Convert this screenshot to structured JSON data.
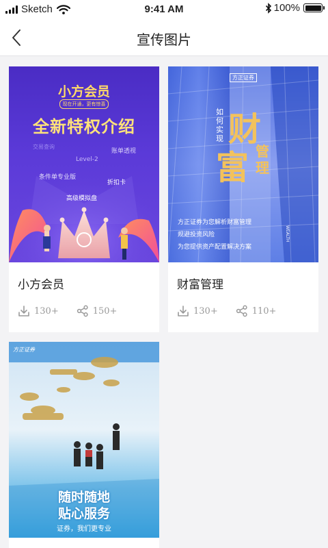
{
  "status_bar": {
    "carrier": "Sketch",
    "time": "9:41 AM",
    "battery": "100%"
  },
  "nav": {
    "title": "宣传图片"
  },
  "posters": [
    {
      "title": "小方会员",
      "downloads": "130+",
      "shares": "150+",
      "poster_text": {
        "heading": "小方会员",
        "tagline": "现在开通，更有惊喜",
        "headline": "全新特权介绍",
        "features": [
          "交易查询",
          "账单透视",
          "Level-2",
          "条件单专业版",
          "折扣卡",
          "高级模拟盘"
        ]
      }
    },
    {
      "title": "财富管理",
      "downloads": "130+",
      "shares": "110+",
      "poster_text": {
        "logo": "方正证券",
        "small": "如何实现",
        "big1": "财",
        "big2": "富",
        "side": "管理",
        "lines": [
          "方正证券为您解析财富管理",
          "规避投资风险",
          "为您提供资产配置解决方案"
        ],
        "vertical": "WEALTH"
      }
    },
    {
      "title": "",
      "downloads": "",
      "shares": "",
      "poster_text": {
        "logo": "方正证券",
        "line1": "随时随地",
        "line2": "贴心服务",
        "slogan": "证券，我们更专业"
      }
    }
  ]
}
